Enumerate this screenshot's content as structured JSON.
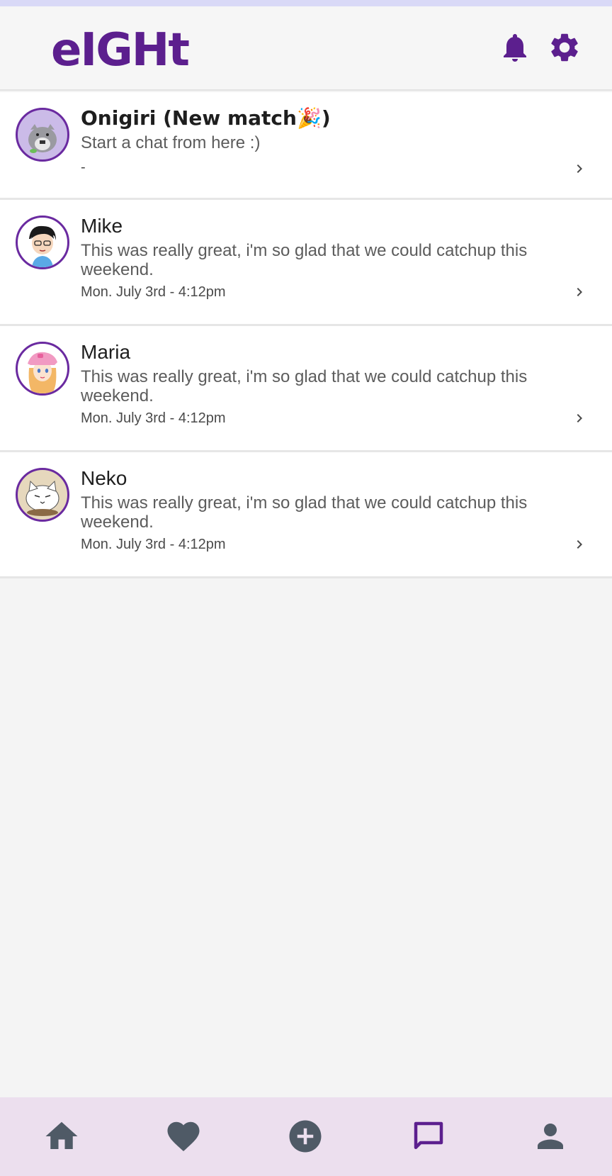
{
  "header": {
    "logo_text": "eIGHt",
    "icons": [
      "bell-icon",
      "gear-icon"
    ]
  },
  "colors": {
    "brand": "#5c1f8e",
    "header_bg": "#f6f6f6",
    "nav_bg": "#ecdfee",
    "page_bg": "#f4f4f4",
    "top_strip": "#d9d9f7"
  },
  "chats": [
    {
      "name": "Onigiri (New match🎉)",
      "message": "Start a chat from here :)",
      "time": "-",
      "avatar": "onigiri-avatar"
    },
    {
      "name": "Mike",
      "message": "This was really great, i'm so glad that we could  catchup this weekend.",
      "time": "Mon. July 3rd - 4:12pm",
      "avatar": "mike-avatar"
    },
    {
      "name": "Maria",
      "message": "This was really great, i'm so glad that we could  catchup this weekend.",
      "time": "Mon. July 3rd - 4:12pm",
      "avatar": "maria-avatar"
    },
    {
      "name": "Neko",
      "message": "This was really great, i'm so glad that we could  catchup this weekend.",
      "time": "Mon. July 3rd - 4:12pm",
      "avatar": "neko-avatar"
    }
  ],
  "bottom_nav": {
    "items": [
      "home-icon",
      "heart-icon",
      "add-icon",
      "chat-icon",
      "profile-icon"
    ],
    "active": "chat-icon"
  }
}
